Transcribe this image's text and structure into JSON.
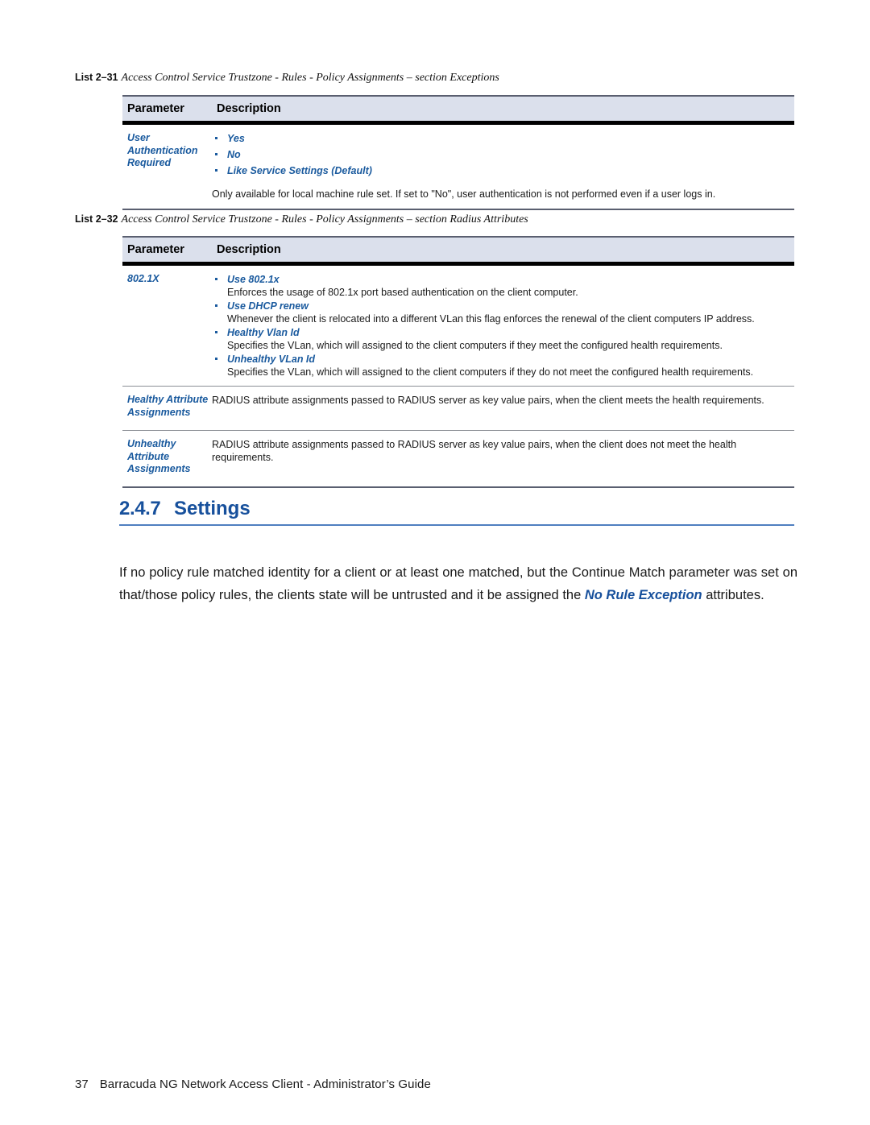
{
  "page": {
    "footer_page_number": "37",
    "footer_title": "Barracuda NG Network Access Client - Administrator’s Guide",
    "accent_blue": "#17509c",
    "term_blue": "#1a5a9e",
    "table_header_bg": "#dbe0ec"
  },
  "table1": {
    "caption_label": "List 2–31",
    "caption_text": "Access Control Service Trustzone - Rules - Policy Assignments – section Exceptions",
    "header": {
      "parameter": "Parameter",
      "description": "Description"
    },
    "rows": [
      {
        "parameter": "User Authentication Required",
        "bullets": [
          "Yes",
          "No",
          "Like Service Settings (Default)"
        ],
        "note": "Only available for local machine rule set. If set to \"No\", user authentication is not performed even if a user logs in."
      }
    ]
  },
  "table2": {
    "caption_label": "List 2–32",
    "caption_text": "Access Control Service Trustzone - Rules - Policy Assignments – section Radius Attributes",
    "header": {
      "parameter": "Parameter",
      "description": "Description"
    },
    "rows": [
      {
        "parameter": "802.1X",
        "items": [
          {
            "term": "Use 802.1x",
            "desc": "Enforces the usage of 802.1x port based authentication on the client computer."
          },
          {
            "term": "Use DHCP renew",
            "desc": "Whenever the client is relocated into a different VLan this flag enforces the renewal of the client computers IP address."
          },
          {
            "term": "Healthy Vlan Id",
            "desc": "Specifies the VLan, which will assigned to the client computers if they meet the configured health requirements."
          },
          {
            "term": "Unhealthy VLan Id",
            "desc": "Specifies the VLan, which will assigned to the client computers if they do not meet the configured health requirements."
          }
        ]
      },
      {
        "parameter": "Healthy Attribute Assignments",
        "text": "RADIUS attribute assignments passed to RADIUS server as key value pairs, when the client meets the health requirements."
      },
      {
        "parameter": "Unhealthy Attribute Assignments",
        "text": "RADIUS attribute assignments passed to RADIUS server as key value pairs, when the client does not meet the health requirements."
      }
    ]
  },
  "section": {
    "number": "2.4.7",
    "title": "Settings",
    "paragraph_part1": "If no policy rule matched identity for a client or at least one matched, but the Continue Match parameter was set on that/those policy rules, the clients state will be untrusted and it be assigned the ",
    "paragraph_highlight": "No Rule Exception",
    "paragraph_part2": " attributes."
  }
}
